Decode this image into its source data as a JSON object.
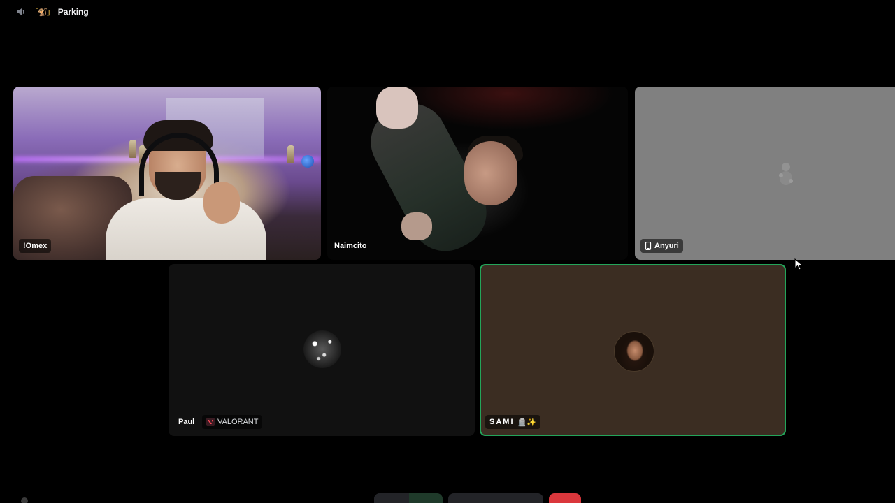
{
  "header": {
    "channel_emoji": "「🐒」",
    "channel_name": "Parking"
  },
  "tiles": [
    {
      "name": "!Omex",
      "type": "video"
    },
    {
      "name": "Naimcito",
      "type": "video"
    },
    {
      "name": "Anyuri",
      "type": "avatar",
      "device": "mobile"
    },
    {
      "name": "Paul",
      "type": "avatar",
      "activity": "VALORANT"
    },
    {
      "name": "SAMI",
      "name_suffix": "🪦✨",
      "type": "avatar",
      "speaking": true
    }
  ],
  "colors": {
    "background": "#000000",
    "speaking_border": "#23a55a",
    "disconnect": "#da373c",
    "tile_dark": "#111111",
    "tile_gray": "#808080",
    "tile_brown": "#3b2d22"
  },
  "icons": {
    "header": "speaker-icon",
    "anyuri_status": "phone-icon",
    "paul_activity": "valorant-icon"
  }
}
